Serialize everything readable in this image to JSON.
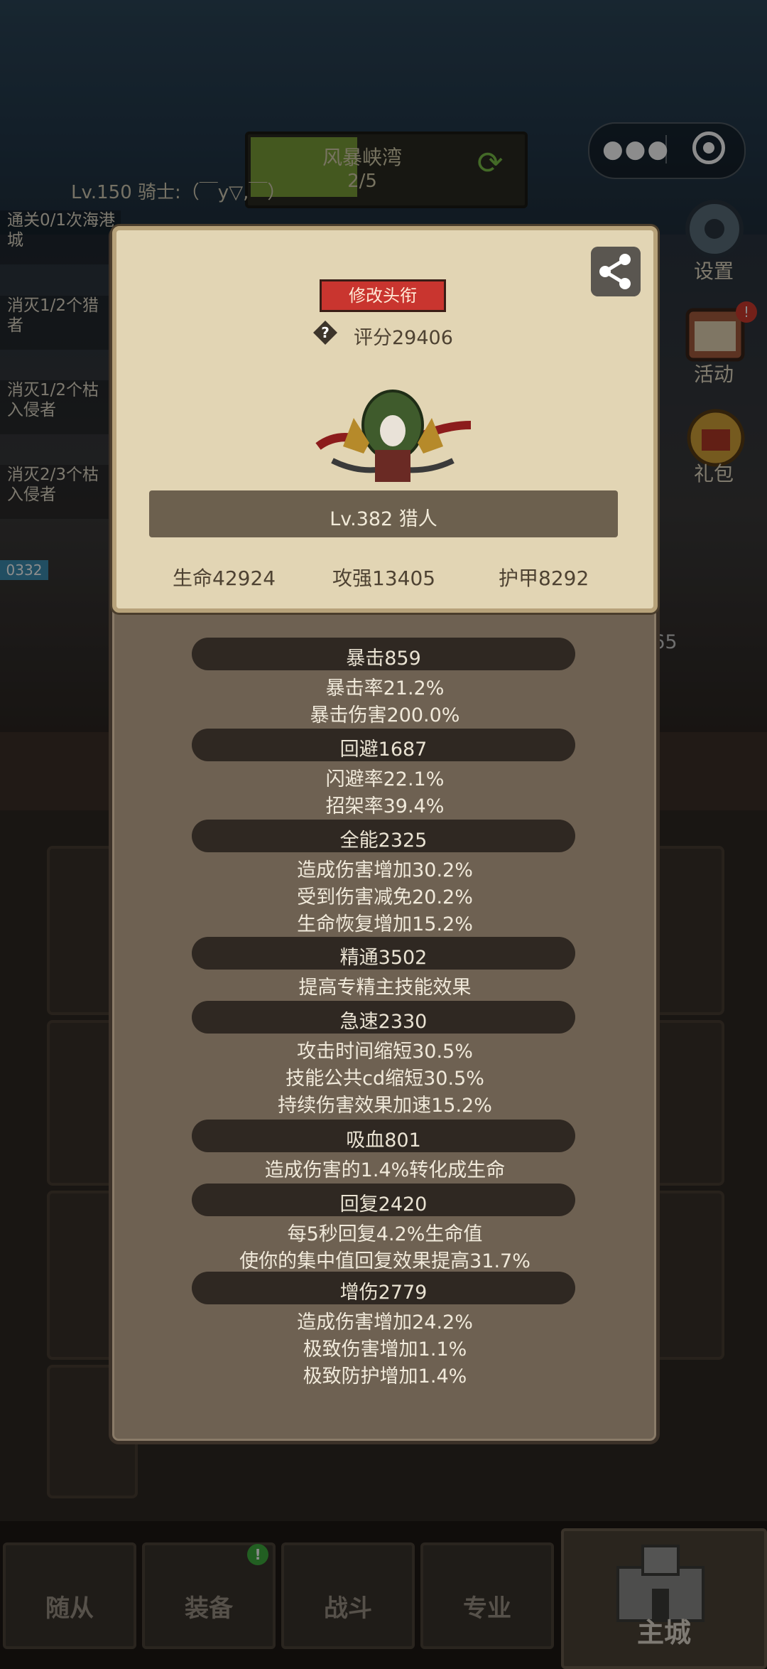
{
  "scene": {
    "stage_name": "风暴峡湾",
    "stage_progress": "2/5",
    "player_level": "Lv.150 骑士:（￣y▽,￣）",
    "quests": [
      "通关0/1次海港\n城",
      "消灭1/2个猎\n者",
      "消灭1/2个枯\n入侵者",
      "消灭2/3个枯\n入侵者"
    ],
    "side_menu": [
      {
        "label": "设置",
        "icon": "gear-icon"
      },
      {
        "label": "活动",
        "icon": "calendar-icon"
      },
      {
        "label": "礼包",
        "icon": "gift-icon"
      }
    ],
    "side_tag": "0332",
    "exp_text": "Exp+7965"
  },
  "nav": {
    "items": [
      "随从",
      "装备",
      "战斗",
      "专业"
    ],
    "main": "主城",
    "equipment_badge": "!"
  },
  "profile": {
    "title_button": "修改头衔",
    "score": "评分29406",
    "name": "Lv.382 猎人",
    "hp": "生命42924",
    "attack": "攻强13405",
    "armor": "护甲8292"
  },
  "stats": [
    {
      "header": "暴击859",
      "lines": [
        "暴击率21.2%",
        "暴击伤害200.0%"
      ]
    },
    {
      "header": "回避1687",
      "lines": [
        "闪避率22.1%",
        "招架率39.4%"
      ]
    },
    {
      "header": "全能2325",
      "lines": [
        "造成伤害增加30.2%",
        "受到伤害减免20.2%",
        "生命恢复增加15.2%"
      ]
    },
    {
      "header": "精通3502",
      "lines": [
        "提高专精主技能效果"
      ]
    },
    {
      "header": "急速2330",
      "lines": [
        "攻击时间缩短30.5%",
        "技能公共cd缩短30.5%",
        "持续伤害效果加速15.2%"
      ]
    },
    {
      "header": "吸血801",
      "lines": [
        "造成伤害的1.4%转化成生命"
      ]
    },
    {
      "header": "回复2420",
      "lines": [
        "每5秒回复4.2%生命值",
        "使你的集中值回复效果提高31.7%"
      ]
    },
    {
      "header": "增伤2779",
      "lines": [
        "造成伤害增加24.2%",
        "极致伤害增加1.1%",
        "极致防护增加1.4%"
      ]
    }
  ]
}
